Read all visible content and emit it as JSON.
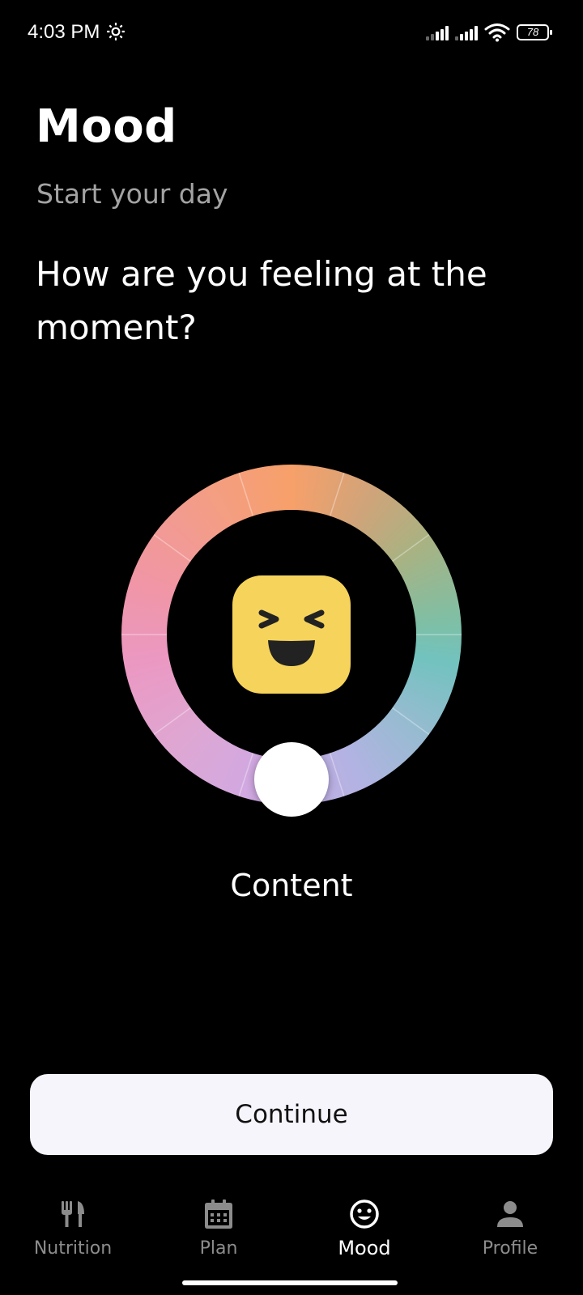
{
  "status_bar": {
    "time": "4:03 PM",
    "battery": "78",
    "settings_icon": "gear-icon",
    "signal_icon": "cellular-signal-icon",
    "wifi_icon": "wifi-icon"
  },
  "header": {
    "title": "Mood",
    "subtitle": "Start your day",
    "question": "How are you feeling at the moment?"
  },
  "mood_wheel": {
    "selected_mood": "Content",
    "emoji_icon": "laughing-face-icon",
    "colors": {
      "top": "#f7a06a",
      "right": "#72c2bf",
      "bottom": "#c0b0e6",
      "left": "#eb98c2",
      "emoji_bg": "#f6d35b"
    }
  },
  "actions": {
    "continue_label": "Continue"
  },
  "bottom_nav": {
    "items": [
      {
        "label": "Nutrition",
        "icon": "fork-knife-icon",
        "active": false
      },
      {
        "label": "Plan",
        "icon": "calendar-icon",
        "active": false
      },
      {
        "label": "Mood",
        "icon": "smiley-icon",
        "active": true
      },
      {
        "label": "Profile",
        "icon": "person-icon",
        "active": false
      }
    ]
  }
}
